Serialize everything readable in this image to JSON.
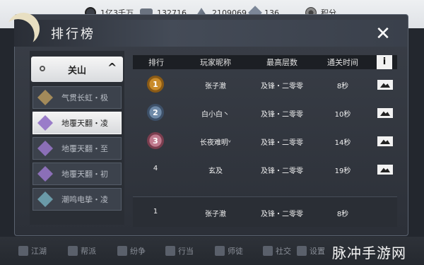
{
  "currencies": [
    {
      "icon": "coin-icon",
      "value": "1亿3千万"
    },
    {
      "icon": "silver-ingot-icon",
      "value": "132716"
    },
    {
      "icon": "fan-icon",
      "value": "2109069"
    },
    {
      "icon": "gem-icon",
      "value": "136"
    },
    {
      "icon": "points-flower-icon",
      "value": "积分"
    }
  ],
  "panel": {
    "title": "排行榜",
    "close": "✕"
  },
  "dropdown": {
    "label": "关山",
    "arrow": "^"
  },
  "stages": [
    {
      "label": "气贯长虹・极"
    },
    {
      "label": "地覆天翻・凌",
      "selected": true
    },
    {
      "label": "地覆天翻・至"
    },
    {
      "label": "地覆天翻・初"
    },
    {
      "label": "潮鸣电挚・凌"
    }
  ],
  "table": {
    "headers": [
      "排行",
      "玩家昵称",
      "最高层数",
      "通关时间",
      "i"
    ],
    "rows": [
      {
        "rank": "1",
        "name": "张子澈",
        "floor": "及锋・二零零",
        "time": "8秒"
      },
      {
        "rank": "2",
        "name": "白小白丶",
        "floor": "及锋・二零零",
        "time": "10秒"
      },
      {
        "rank": "3",
        "name": "长夜难明ᵛ",
        "floor": "及锋・二零零",
        "time": "14秒"
      },
      {
        "rank": "4",
        "name": "玄及",
        "floor": "及锋・二零零",
        "time": "19秒"
      }
    ],
    "my_row": {
      "rank": "1",
      "name": "张子澈",
      "floor": "及锋・二零零",
      "time": "8秒"
    }
  },
  "bottom_nav": [
    "江湖",
    "帮派",
    "纷争",
    "行当",
    "师徒",
    "社交",
    "设置"
  ],
  "watermark": "脉冲手游网"
}
